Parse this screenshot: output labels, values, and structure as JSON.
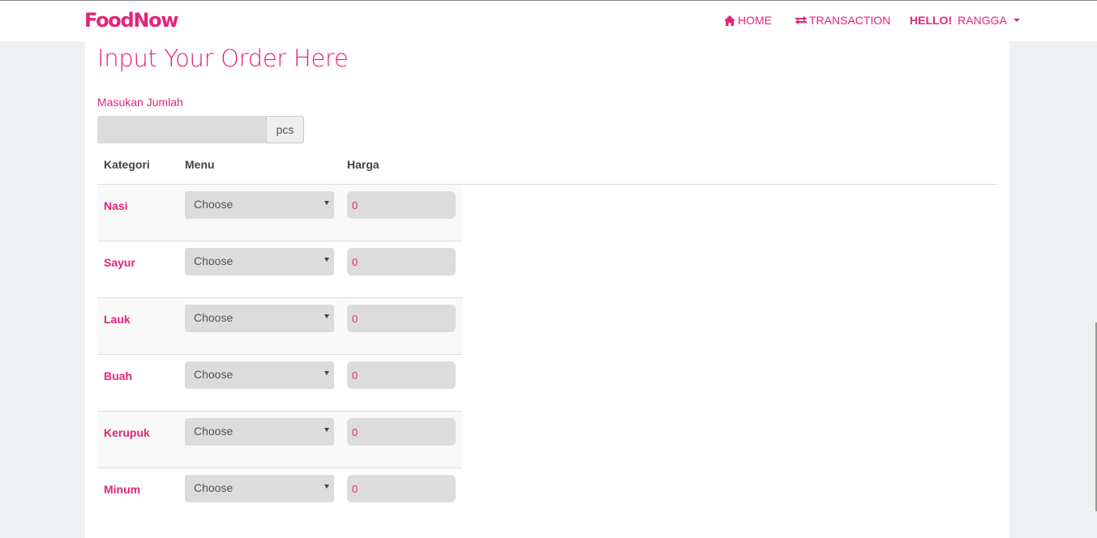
{
  "header": {
    "brand": "FoodNow",
    "nav": {
      "home": "HOME",
      "transaction": "TRANSACTION",
      "hello": "HELLO!",
      "user": "RANGGA"
    }
  },
  "main": {
    "title": "Input Your Order Here",
    "quantity": {
      "label": "Masukan Jumlah",
      "value": "",
      "unit": "pcs"
    },
    "table": {
      "headers": [
        "Kategori",
        "Menu",
        "Harga"
      ],
      "rows": [
        {
          "category": "Nasi",
          "menu": "Choose",
          "price": "0"
        },
        {
          "category": "Sayur",
          "menu": "Choose",
          "price": "0"
        },
        {
          "category": "Lauk",
          "menu": "Choose",
          "price": "0"
        },
        {
          "category": "Buah",
          "menu": "Choose",
          "price": "0"
        },
        {
          "category": "Kerupuk",
          "menu": "Choose",
          "price": "0"
        },
        {
          "category": "Minum",
          "menu": "Choose",
          "price": "0"
        }
      ]
    }
  },
  "colors": {
    "accent": "#e4247b",
    "field_bg": "#dcdcdc",
    "page_bg": "#eef1f4"
  },
  "icons": {
    "home": "home-icon",
    "transaction": "transfer-icon",
    "user_menu": "caret-down-icon",
    "select": "select-arrow-icon"
  }
}
